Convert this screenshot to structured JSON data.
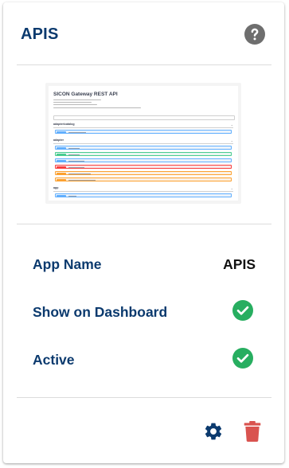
{
  "card": {
    "title": "APIS",
    "help_icon": "help-circle-icon"
  },
  "preview": {
    "title": "SICON Gateway REST API",
    "sections": [
      {
        "name": "adapter/catalog",
        "rows": [
          "get"
        ]
      },
      {
        "name": "adapter",
        "rows": [
          "get",
          "post",
          "get",
          "delete",
          "put",
          "put"
        ]
      },
      {
        "name": "app",
        "rows": [
          "get"
        ]
      }
    ]
  },
  "details": {
    "app_name_label": "App Name",
    "app_name_value": "APIS",
    "show_on_dashboard_label": "Show on Dashboard",
    "show_on_dashboard_value": true,
    "active_label": "Active",
    "active_value": true
  },
  "actions": {
    "settings_icon": "gear-icon",
    "delete_icon": "trash-icon"
  },
  "colors": {
    "title": "#0b3a6e",
    "help_icon": "#6e6e6e",
    "check": "#27ae60",
    "gear": "#0b3a6e",
    "trash": "#d9534f",
    "divider": "#dcdcdc"
  }
}
